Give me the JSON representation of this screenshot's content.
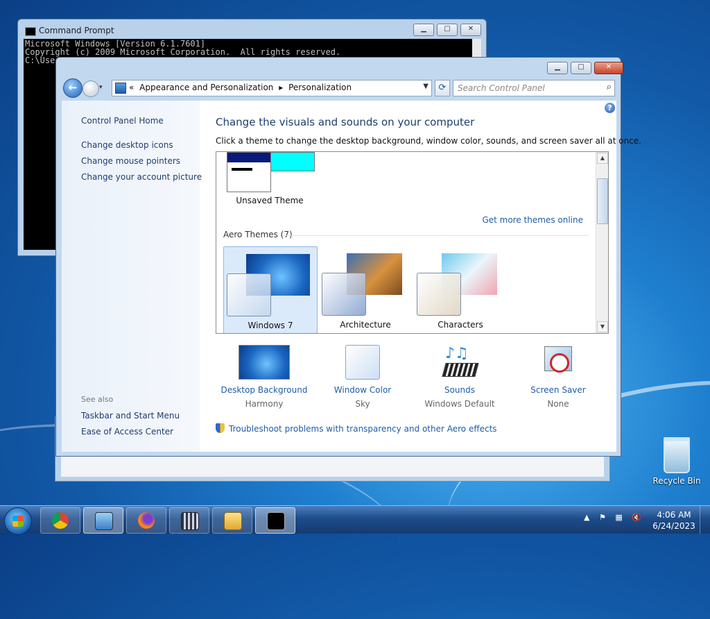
{
  "desktop": {
    "recycle_label": "Recycle Bin"
  },
  "cmd": {
    "title": "Command Prompt",
    "lines": [
      "Microsoft Windows [Version 6.1.7601]",
      "Copyright (c) 2009 Microsoft Corporation.  All rights reserved.",
      "",
      "C:\\Use"
    ]
  },
  "window": {
    "breadcrumb": [
      "«",
      "Appearance and Personalization",
      "▸",
      "Personalization"
    ],
    "search_placeholder": "Search Control Panel"
  },
  "sidebar": {
    "home": "Control Panel Home",
    "links": [
      "Change desktop icons",
      "Change mouse pointers",
      "Change your account picture"
    ],
    "see_also_label": "See also",
    "see_also_links": [
      "Taskbar and Start Menu",
      "Ease of Access Center"
    ]
  },
  "content": {
    "heading": "Change the visuals and sounds on your computer",
    "subheading": "Click a theme to change the desktop background, window color, sounds, and screen saver all at once.",
    "unsaved_theme_label": "Unsaved Theme",
    "more_themes_link": "Get more themes online",
    "aero_group_title": "Aero Themes (7)",
    "themes": [
      {
        "name": "Windows 7",
        "selected": true
      },
      {
        "name": "Architecture",
        "selected": false
      },
      {
        "name": "Characters",
        "selected": false
      }
    ],
    "bottom_items": [
      {
        "label": "Desktop Background",
        "value": "Harmony"
      },
      {
        "label": "Window Color",
        "value": "Sky"
      },
      {
        "label": "Sounds",
        "value": "Windows Default"
      },
      {
        "label": "Screen Saver",
        "value": "None"
      }
    ],
    "troubleshoot_link": "Troubleshoot problems with transparency and other Aero effects"
  },
  "taskbar": {
    "time": "4:06 AM",
    "date": "6/24/2023"
  },
  "colors": {
    "link": "#1e5ca8",
    "heading": "#1e3d6e",
    "unsaved_color": "#00ffff"
  }
}
